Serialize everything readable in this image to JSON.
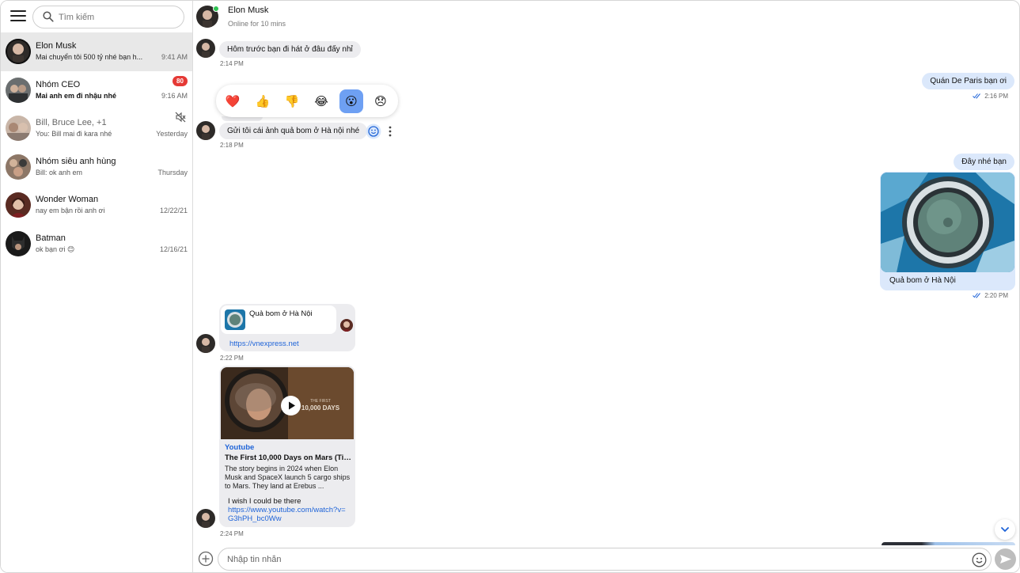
{
  "search": {
    "placeholder": "Tìm kiếm"
  },
  "conversations": [
    {
      "name": "Elon Musk",
      "preview": "Mai chuyển tôi 500 tỷ nhé bạn h...",
      "time": "9:41 AM",
      "active": true
    },
    {
      "name": "Nhóm CEO",
      "preview": "Mai anh em đi nhậu nhé",
      "time": "9:16 AM",
      "badge": "80"
    },
    {
      "name": "Bill, Bruce Lee, +1",
      "preview": "You: Bill mai đi kara nhé",
      "time": "Yesterday",
      "muted": true
    },
    {
      "name": "Nhóm siêu anh hùng",
      "preview": "Bill: ok anh em",
      "time": "Thursday"
    },
    {
      "name": "Wonder Woman",
      "preview": "nay em bận rồi anh ơi",
      "time": "12/22/21"
    },
    {
      "name": "Batman",
      "preview": "ok bạn ơi 😊",
      "time": "12/16/21"
    }
  ],
  "header": {
    "name": "Elon Musk",
    "status": "Online for 10 mins"
  },
  "messages": {
    "m1": {
      "text": "Hôm trước bạn đi hát ở đâu đấy nhỉ",
      "time": "2:14 PM"
    },
    "m2": {
      "text": "Quán De Paris bạn ơi",
      "time": "2:16 PM"
    },
    "m3": {
      "text": "Gửi tôi cái ảnh quả bom ở Hà nội nhé",
      "time": "2:18 PM"
    },
    "m4": {
      "text": "Đây nhé bạn"
    },
    "m5": {
      "caption": "Quả bom ở Hà Nội",
      "time": "2:20 PM"
    },
    "m6": {
      "title": "Quả bom ở Hà Nội",
      "url": "https://vnexpress.net",
      "time": "2:22 PM"
    },
    "m7": {
      "source": "Youtube",
      "title": "The First 10,000 Days on Mars (Tim...",
      "description": "The story begins in 2024 when Elon Musk and SpaceX launch 5 cargo ships to Mars. They land at Erebus ...",
      "comment": "I wish I could be there",
      "url": "https://www.youtube.com/watch?v=G3hPH_bc0Ww",
      "thumb_text_1": "THE FIRST",
      "thumb_text_2": "10,000 DAYS",
      "time": "2:24 PM"
    }
  },
  "reactions": [
    {
      "emoji": "❤️",
      "icon": "heart-icon"
    },
    {
      "emoji": "👍",
      "icon": "thumbs-up-icon"
    },
    {
      "emoji": "👎",
      "icon": "thumbs-down-icon"
    },
    {
      "emoji": "😂",
      "icon": "laugh-icon"
    },
    {
      "emoji": "😮",
      "icon": "wow-icon",
      "selected": true
    },
    {
      "emoji": "😞",
      "icon": "sad-icon"
    }
  ],
  "composer": {
    "placeholder": "Nhập tin nhắn"
  },
  "colors": {
    "accent": "#1f64d8",
    "outgoing_bubble": "#dbe8fb",
    "incoming_bubble": "#ececef",
    "badge": "#e53935",
    "online": "#31c454",
    "selected_reaction": "#6ea0f3"
  }
}
